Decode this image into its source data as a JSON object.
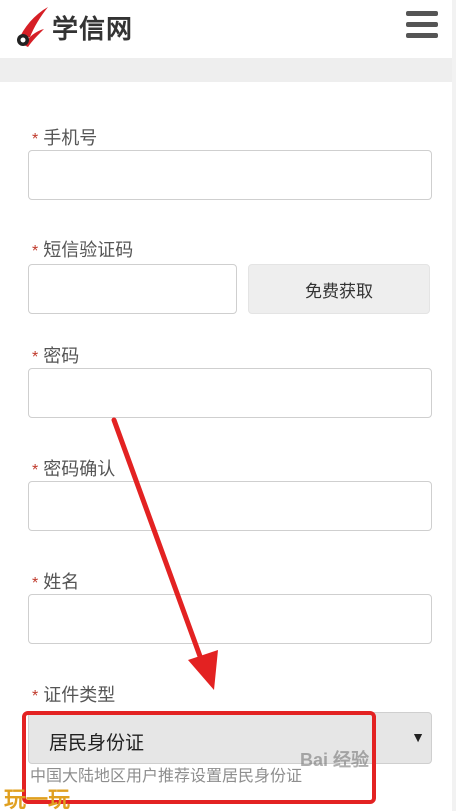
{
  "header": {
    "site_name": "学信网",
    "menu_icon": "hamburger-menu-icon"
  },
  "form": {
    "required_mark": "*",
    "phone_label": "手机号",
    "sms_code_label": "短信验证码",
    "get_code_button": "免费获取",
    "password_label": "密码",
    "confirm_password_label": "密码确认",
    "name_label": "姓名",
    "id_type_label": "证件类型",
    "id_type_selected": "居民身份证",
    "id_type_hint": "中国大陆地区用户推荐设置居民身份证",
    "caret": "▼"
  },
  "watermark": {
    "right": "Bai 经验",
    "left": "玩一玩"
  },
  "colors": {
    "required": "#c0392b",
    "highlight": "#e32222",
    "arrow": "#e32222"
  }
}
